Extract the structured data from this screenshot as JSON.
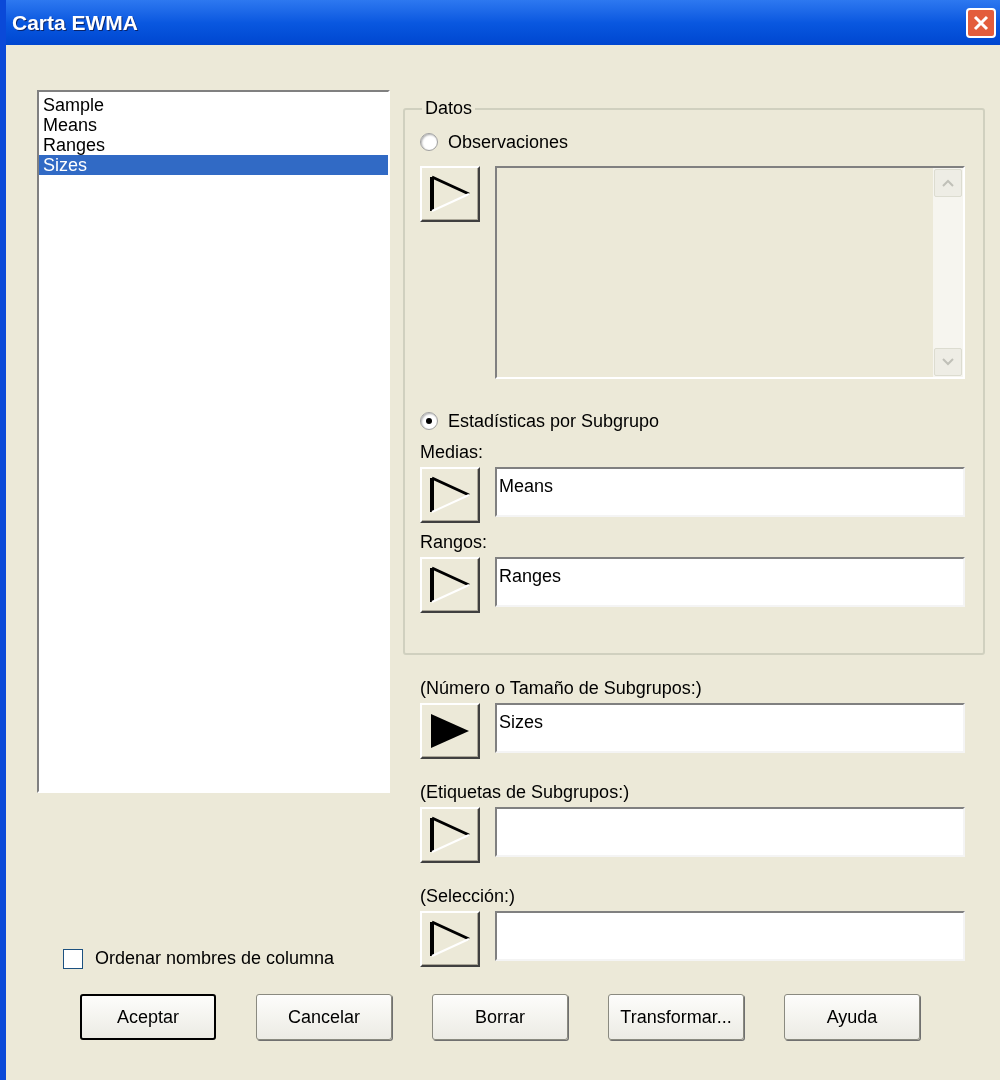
{
  "window": {
    "title": "Carta EWMA"
  },
  "columns_list": {
    "items": [
      {
        "label": "Sample",
        "selected": false
      },
      {
        "label": "Means",
        "selected": false
      },
      {
        "label": "Ranges",
        "selected": false
      },
      {
        "label": "Sizes",
        "selected": true
      }
    ]
  },
  "sort_option": {
    "label": "Ordenar nombres de columna",
    "checked": false
  },
  "data_group": {
    "title": "Datos",
    "options": [
      {
        "label": "Observaciones",
        "selected": false
      },
      {
        "label": "Estadísticas por Subgrupo",
        "selected": true
      }
    ],
    "observations_selector": {
      "filled": false
    },
    "fields": [
      {
        "label": "Medias:",
        "value": "Means",
        "filled": false
      },
      {
        "label": "Rangos:",
        "value": "Ranges",
        "filled": false
      }
    ]
  },
  "extra_fields": [
    {
      "label": "(Número o Tamaño de Subgrupos:)",
      "value": "Sizes",
      "filled": true
    },
    {
      "label": "(Etiquetas de Subgrupos:)",
      "filled": false
    },
    {
      "label": "(Selección:)",
      "filled": false
    }
  ],
  "buttons": [
    {
      "label": "Aceptar",
      "default": true
    },
    {
      "label": "Cancelar",
      "default": false
    },
    {
      "label": "Borrar",
      "default": false
    },
    {
      "label": "Transformar...",
      "default": false
    },
    {
      "label": "Ayuda",
      "default": false
    }
  ]
}
